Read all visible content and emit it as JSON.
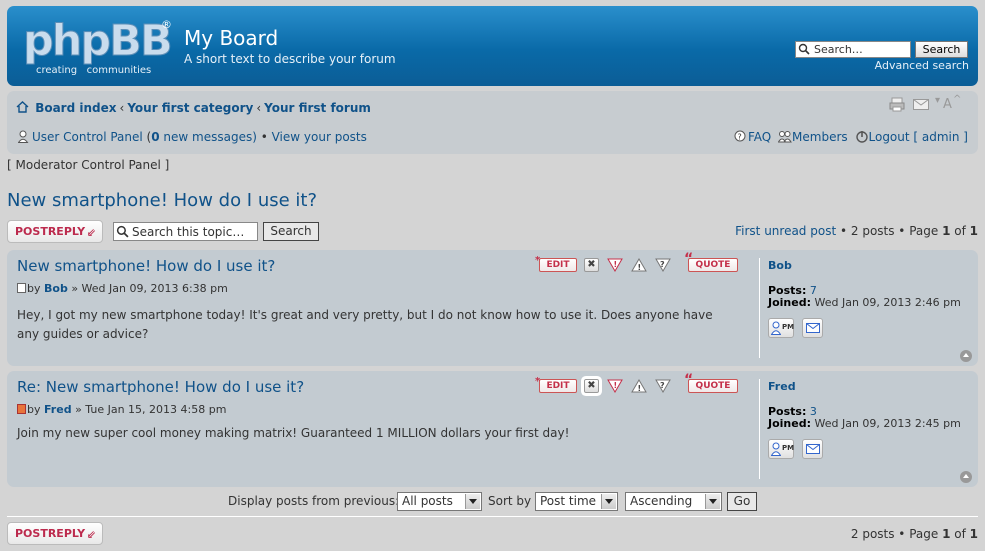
{
  "header": {
    "logo_main": "phpBB",
    "logo_reg": "®",
    "logo_tagline": "creating   communities",
    "site_title": "My Board",
    "site_description": "A short text to describe your forum",
    "search_placeholder": "Search…",
    "search_button": "Search",
    "advanced_search": "Advanced search"
  },
  "navbar": {
    "breadcrumbs": [
      "Board index",
      "Your first category",
      "Your first forum"
    ],
    "breadcrumb_sep": "‹",
    "ucp_label": "User Control Panel",
    "ucp_open": " (",
    "new_messages_count": "0",
    "new_messages_label": " new messages)",
    "bullet": " • ",
    "view_posts": "View your posts",
    "faq": "FAQ",
    "members": "Members",
    "logout": "Logout [ admin ]",
    "font_size_label": "A"
  },
  "mcp_link": "[ Moderator Control Panel ]",
  "topic": {
    "title": "New smartphone! How do I use it?",
    "post_reply": "POSTREPLY",
    "search_placeholder": "Search this topic…",
    "search_button": "Search",
    "first_unread": "First unread post",
    "pagination_top": " • 2 posts • Page ",
    "page_current": "1",
    "page_of": " of ",
    "page_total": "1",
    "pagination_bottom": "2 posts • Page "
  },
  "post_buttons": {
    "edit": "EDIT",
    "quote": "QUOTE",
    "delete": "✖",
    "report": "!",
    "warn": "!",
    "info": "?"
  },
  "posts": [
    {
      "title": "New smartphone! How do I use it?",
      "by": "by ",
      "author": "Bob",
      "date": " » Wed Jan 09, 2013 6:38 pm",
      "content": "Hey, I got my new smartphone today! It's great and very pretty, but I do not know how to use it. Does anyone have any guides or advice?",
      "profile_name": "Bob",
      "posts_label": "Posts:",
      "posts_value": " 7",
      "joined_label": "Joined:",
      "joined_value": " Wed Jan 09, 2013 2:46 pm",
      "pm": "PM"
    },
    {
      "title": "Re: New smartphone! How do I use it?",
      "by": "by ",
      "author": "Fred",
      "date": " » Tue Jan 15, 2013 4:58 pm",
      "content": "Join my new super cool money making matrix! Guaranteed 1 MILLION dollars your first day!",
      "profile_name": "Fred",
      "posts_label": "Posts:",
      "posts_value": " 3",
      "joined_label": "Joined:",
      "joined_value": " Wed Jan 09, 2013 2:45 pm",
      "pm": "PM"
    }
  ],
  "display_bar": {
    "label": "Display posts from previous:",
    "posts_select": "All posts",
    "sort_label": "Sort by",
    "sort_select": "Post time",
    "order_select": "Ascending",
    "go": "Go"
  },
  "colors": {
    "header_blue": "#0a6aa8",
    "link": "#105289",
    "post_bg": "#c3cbd1",
    "accent_red": "#bc2a4d"
  }
}
